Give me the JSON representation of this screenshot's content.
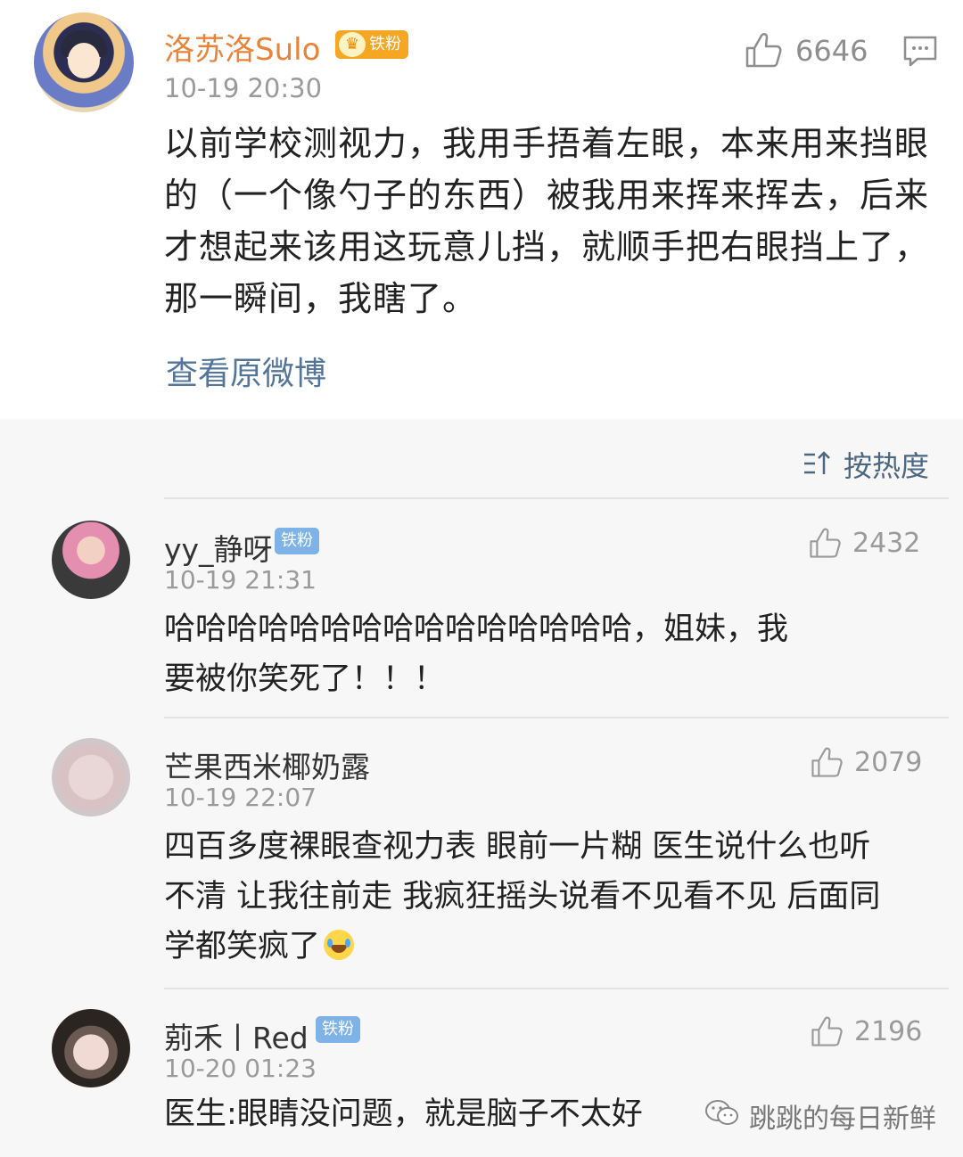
{
  "post": {
    "username": "洛苏洛Sulo",
    "badge": "铁粉",
    "time": "10-19 20:30",
    "likes": "6646",
    "text_lines": [
      "以前学校测视力，我用手捂着左眼，本来用来挡眼",
      "的（一个像勺子的东西）被我用来挥来挥去，后来",
      "才想起来该用这玩意儿挡，就顺手把右眼挡上了，",
      "那一瞬间，我瞎了。"
    ],
    "view_original": "查看原微博",
    "icons": {
      "like": "thumb-up-icon",
      "comment": "comment-icon"
    }
  },
  "sort": {
    "label": "按热度",
    "icon": "sort-icon"
  },
  "comments": [
    {
      "username": "yy_静呀",
      "badge": "铁粉",
      "time": "10-19 21:31",
      "likes": "2432",
      "lines": [
        "哈哈哈哈哈哈哈哈哈哈哈哈哈哈哈，姐妹，我",
        "要被你笑死了！！！"
      ]
    },
    {
      "username": "芒果西米椰奶露",
      "badge": "",
      "time": "10-19 22:07",
      "likes": "2079",
      "lines": [
        "四百多度裸眼查视力表 眼前一片糊 医生说什么也听",
        "不清 让我往前走 我疯狂摇头说看不见看不见 后面同",
        "学都笑疯了"
      ]
    },
    {
      "username": "莂禾丨Red",
      "badge": "铁粉",
      "time": "10-20 01:23",
      "likes": "2196",
      "lines": [
        "医生:眼睛没问题，就是脑子不太好"
      ]
    }
  ],
  "watermark": "跳跳的每日新鲜",
  "colors": {
    "username_main": "#e8843a",
    "link": "#53759a",
    "badge_blue": "#7fb3e8",
    "badge_gold": "#f5a623"
  }
}
